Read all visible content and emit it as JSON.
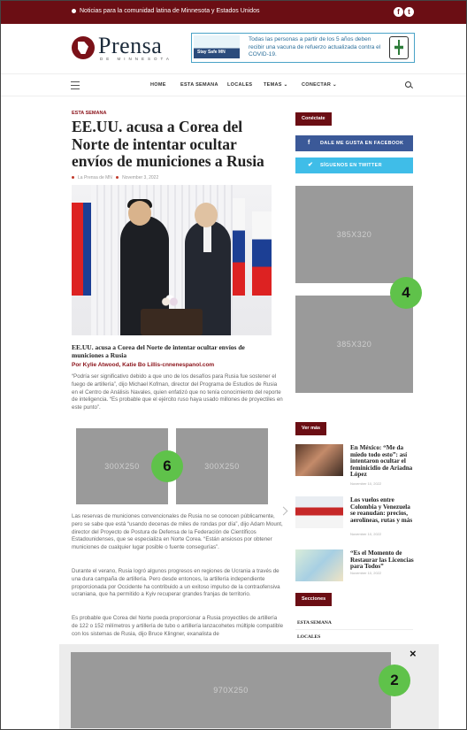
{
  "topbar": {
    "text": "Noticias para la comunidad latina de Minnesota y Estados Unidos",
    "social": [
      "f",
      "t"
    ]
  },
  "brand": {
    "name": "Prensa",
    "sub": "DE MINNESOTA"
  },
  "header_ad": {
    "text": "Todas las personas a partir de los 5 años deben recibir una vacuna de refuerzo actualizada contra el COVID-19.",
    "logo": "Stay Safe MN"
  },
  "nav": {
    "items": [
      "HOME",
      "ESTA SEMANA",
      "LOCALES",
      "TEMAS ⌄",
      "CONECTAR ⌄"
    ]
  },
  "article": {
    "category": "ESTA SEMANA",
    "title": "EE.UU. acusa a Corea del Norte de intentar ocultar envíos de municiones a Rusia",
    "author": "La Prensa de MN",
    "date": "November 3, 2022",
    "caption": "EE.UU. acusa a Corea del Norte de intentar ocultar envíos de municiones a Rusia",
    "byline": "Por Kylie Atwood, Katie Bo Lillis-cnnenespanol.com",
    "p1": "“Podría ser significativo debido a que uno de los desafíos para Rusia fue sostener el fuego de artillería”, dijo Michael Kofman, director del Programa de Estudios de Rusia en el Centro de Análisis Navales, quien enfatizó que no tenía conocimiento del reporte de inteligencia. “Es probable que el ejército ruso haya usado millones de proyectiles en este punto”.",
    "p2": "Las reservas de municiones convencionales de Rusia no se conocen públicamente, pero se sabe que está “usando decenas de miles de rondas por día”, dijo Adam Mount, director del Proyecto de Postura de Defensa de la Federación de Científicos Estadounidenses, que se especializa en Norte Corea. “Están ansiosos por obtener municiones de cualquier lugar posible o fuente consegurías”.",
    "p3": "Durante el verano, Rusia logró algunos progresos en regiones de Ucrania a través de una dura campaña de artillería. Pero desde entonces, la artillería independiente proporcionada por Occidente ha contribuido a un exitoso impulso de la contraofensiva ucraniana, que ha permitido a Kyiv recuperar grandes franjas de territorio.",
    "p4": "Es probable que Corea del Norte pueda proporcionar a Rusia proyectiles de artillería de 122 o 152 milímetros y artillería de tubo o artillería lanzacohetes múltiple compatible con los sistemas de Rusia, dijo Bruce Klingner, exanalista de"
  },
  "ads": {
    "inline_left": "300X250",
    "inline_right": "300X250",
    "side1": "385X320",
    "side2": "385X320",
    "bottom": "970X250"
  },
  "badges": {
    "side": "4",
    "inline": "6",
    "bottom": "2"
  },
  "sidebar": {
    "connect_title": "Conéctate",
    "facebook_label": "DALE ME GUSTA EN FACEBOOK",
    "twitter_label": "SÍGUENOS EN TWITTER",
    "more_title": "Ver más",
    "items": [
      {
        "title": "En México: “Me da miedo todo esto”: así intentaron ocultar el feminicidio de Ariadna López",
        "date": "November 10, 2022"
      },
      {
        "title": "Los vuelos entre Colombia y Venezuela se reanudan: precios, aerolíneas, rutas y más",
        "date": "November 10, 2022"
      },
      {
        "title": "“Es el Momento de Restaurar las Licencias para Todos”",
        "date": "November 10, 2022"
      }
    ],
    "sections_title": "Secciones",
    "sections": [
      "ESTA SEMANA",
      "LOCALES"
    ]
  },
  "overlay": {
    "close": "×"
  },
  "colors": {
    "brand": "#6b0e14",
    "facebook": "#3b5998",
    "twitter": "#3fbde8",
    "badge": "#5fc24a",
    "ad": "#9a9a9a"
  }
}
